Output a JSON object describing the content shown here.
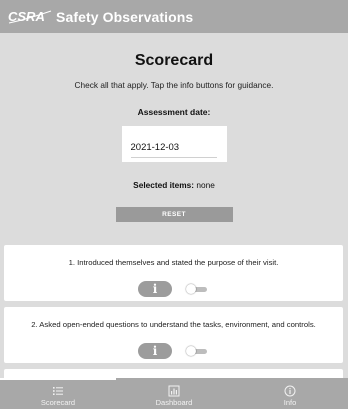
{
  "app": {
    "brand": "CSRA",
    "title": "Safety Observations"
  },
  "scorecard": {
    "title": "Scorecard",
    "instructions": "Check all that apply. Tap the info buttons for guidance.",
    "date_label": "Assessment date:",
    "date_value": "2021-12-03",
    "selected_label": "Selected items:",
    "selected_value": "none",
    "reset_label": "RESET"
  },
  "items": [
    {
      "text": "1. Introduced themselves and stated the purpose of their visit.",
      "info_icon": "i",
      "checked": false
    },
    {
      "text": "2. Asked open-ended questions to understand the tasks, environment, and controls.",
      "info_icon": "i",
      "checked": false
    }
  ],
  "nav": {
    "active_index": 0,
    "items": [
      {
        "label": "Scorecard",
        "icon": "list-icon"
      },
      {
        "label": "Dashboard",
        "icon": "chart-icon"
      },
      {
        "label": "Info",
        "icon": "info-circle-icon"
      }
    ]
  },
  "colors": {
    "bar": "#a8a8a8",
    "background": "#dcdcdc",
    "button": "#9a9a9a"
  }
}
